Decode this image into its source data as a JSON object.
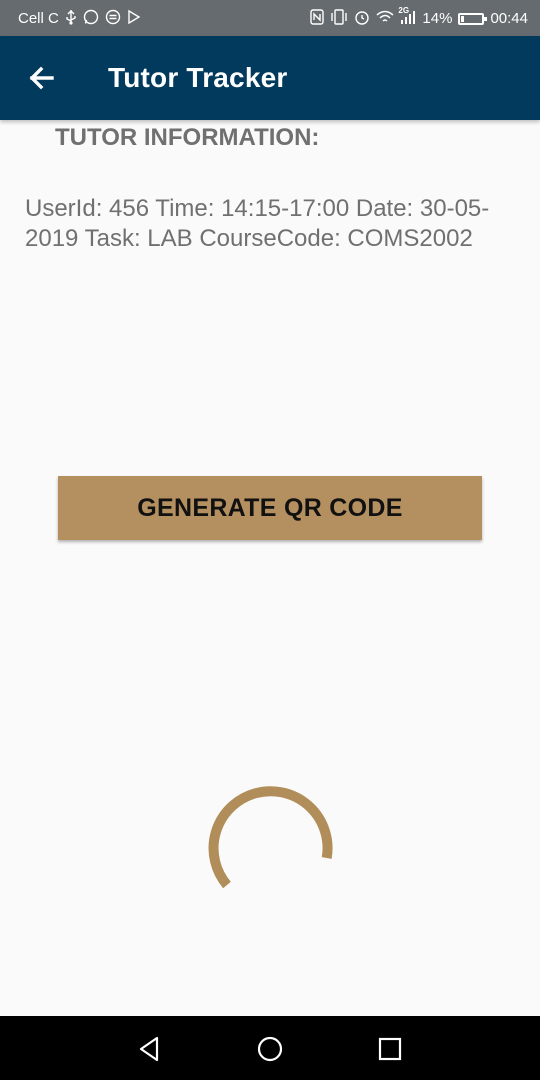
{
  "status_bar": {
    "carrier": "Cell C",
    "network": "2G",
    "battery_percent": "14%",
    "battery_level": 0.14,
    "time": "00:44"
  },
  "app_bar": {
    "title": "Tutor Tracker",
    "back_icon": "arrow-left-icon",
    "color": "#013a5c"
  },
  "tutor": {
    "heading": "TUTOR INFORMATION:",
    "info": "UserId: 456 Time: 14:15-17:00 Date: 30-05-2019 Task: LAB CourseCode: COMS2002"
  },
  "actions": {
    "generate_label": "GENERATE QR CODE",
    "accent_color": "#b49060"
  },
  "nav_bar": {
    "back_icon": "triangle-back-icon",
    "home_icon": "circle-home-icon",
    "recents_icon": "square-recents-icon"
  }
}
